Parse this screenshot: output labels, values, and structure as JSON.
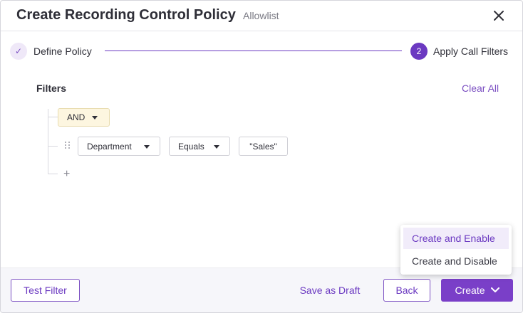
{
  "header": {
    "title": "Create Recording Control Policy",
    "subtitle": "Allowlist",
    "close_icon": "close-icon"
  },
  "stepper": {
    "steps": [
      {
        "label": "Define Policy",
        "state": "completed",
        "marker": "✓"
      },
      {
        "label": "Apply Call Filters",
        "state": "active",
        "marker": "2"
      }
    ]
  },
  "filters": {
    "heading": "Filters",
    "clear_all_label": "Clear All",
    "logic_operator": "AND",
    "rule": {
      "field": "Department",
      "operator": "Equals",
      "value": "\"Sales\""
    },
    "add_symbol": "+"
  },
  "footer": {
    "test_filter_label": "Test Filter",
    "save_draft_label": "Save as Draft",
    "back_label": "Back",
    "create_label": "Create"
  },
  "create_menu": {
    "items": [
      {
        "label": "Create and Enable",
        "highlighted": true
      },
      {
        "label": "Create and Disable",
        "highlighted": false
      }
    ]
  },
  "colors": {
    "accent": "#6b39c1",
    "and_bg": "#fdf6e0",
    "footer_bg": "#f6f6fa"
  }
}
